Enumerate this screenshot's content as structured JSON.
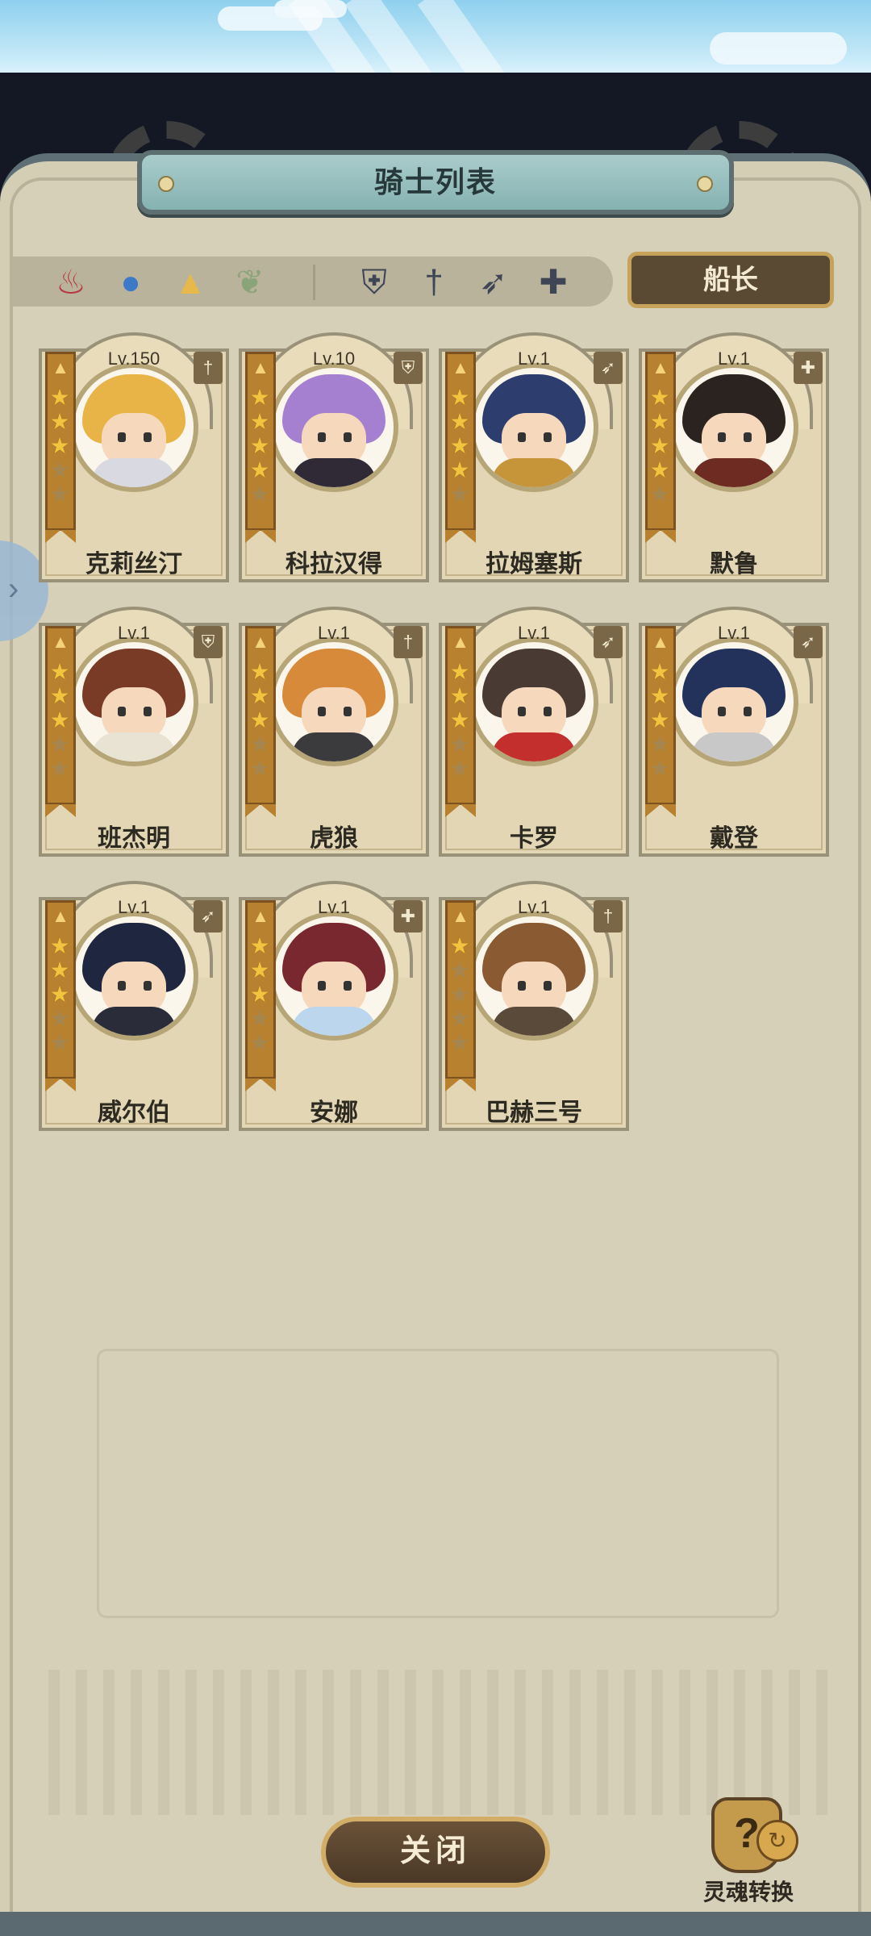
{
  "title": "骑士列表",
  "filters": {
    "elements": [
      {
        "icon": "fire-icon",
        "color": "#b5393e"
      },
      {
        "icon": "water-icon",
        "color": "#3c79c9"
      },
      {
        "icon": "earth-icon",
        "color": "#e7b84a"
      },
      {
        "icon": "wind-icon",
        "color": "#7a9a6a"
      }
    ],
    "classes": [
      {
        "icon": "shield-icon"
      },
      {
        "icon": "sword-icon"
      },
      {
        "icon": "bow-icon"
      },
      {
        "icon": "cross-icon"
      }
    ]
  },
  "captain_label": "船长",
  "knights": [
    {
      "name": "克莉丝汀",
      "level": "Lv.150",
      "stars": 3,
      "class_icon": "sword-icon",
      "hair": "#e8b347",
      "outfit": "#d9d9e2"
    },
    {
      "name": "科拉汉得",
      "level": "Lv.10",
      "stars": 4,
      "class_icon": "shield-icon",
      "hair": "#a57fd0",
      "outfit": "#2f2a36"
    },
    {
      "name": "拉姆塞斯",
      "level": "Lv.1",
      "stars": 4,
      "class_icon": "bow-icon",
      "hair": "#2c3d6e",
      "outfit": "#c6953a"
    },
    {
      "name": "默鲁",
      "level": "Lv.1",
      "stars": 4,
      "class_icon": "cross-icon",
      "hair": "#2a2320",
      "outfit": "#6d2b22"
    },
    {
      "name": "班杰明",
      "level": "Lv.1",
      "stars": 3,
      "class_icon": "shield-icon",
      "hair": "#7a3b26",
      "outfit": "#e9e3d4"
    },
    {
      "name": "虎狼",
      "level": "Lv.1",
      "stars": 3,
      "class_icon": "sword-icon",
      "hair": "#d78a3a",
      "outfit": "#3b3b3d"
    },
    {
      "name": "卡罗",
      "level": "Lv.1",
      "stars": 3,
      "class_icon": "bow-icon",
      "hair": "#4a3a34",
      "outfit": "#c22f2c"
    },
    {
      "name": "戴登",
      "level": "Lv.1",
      "stars": 3,
      "class_icon": "bow-icon",
      "hair": "#23325a",
      "outfit": "#c8c8c8"
    },
    {
      "name": "威尔伯",
      "level": "Lv.1",
      "stars": 3,
      "class_icon": "bow-icon",
      "hair": "#1f2640",
      "outfit": "#2a2c3a"
    },
    {
      "name": "安娜",
      "level": "Lv.1",
      "stars": 3,
      "class_icon": "cross-icon",
      "hair": "#7a2830",
      "outfit": "#bcd6ee"
    },
    {
      "name": "巴赫三号",
      "level": "Lv.1",
      "stars": 1,
      "class_icon": "sword-icon",
      "hair": "#8a5a33",
      "outfit": "#5a4a3a"
    }
  ],
  "close_label": "关闭",
  "soul_convert": {
    "label": "灵魂转换",
    "icon": "question-crystal-icon",
    "glyph": "?"
  }
}
